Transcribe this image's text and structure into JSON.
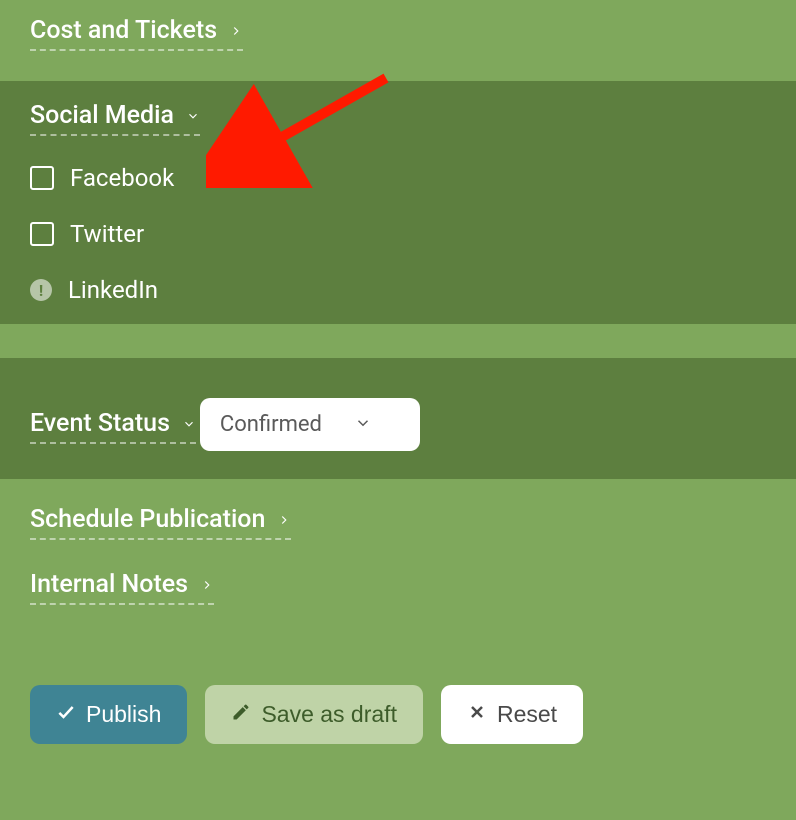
{
  "sections": {
    "cost_tickets": {
      "title": "Cost and Tickets"
    },
    "social_media": {
      "title": "Social Media",
      "options": {
        "facebook": "Facebook",
        "twitter": "Twitter",
        "linkedin": "LinkedIn"
      }
    },
    "event_status": {
      "title": "Event Status",
      "selected": "Confirmed"
    },
    "schedule_publication": {
      "title": "Schedule Publication"
    },
    "internal_notes": {
      "title": "Internal Notes"
    }
  },
  "buttons": {
    "publish": "Publish",
    "save_draft": "Save as draft",
    "reset": "Reset"
  }
}
